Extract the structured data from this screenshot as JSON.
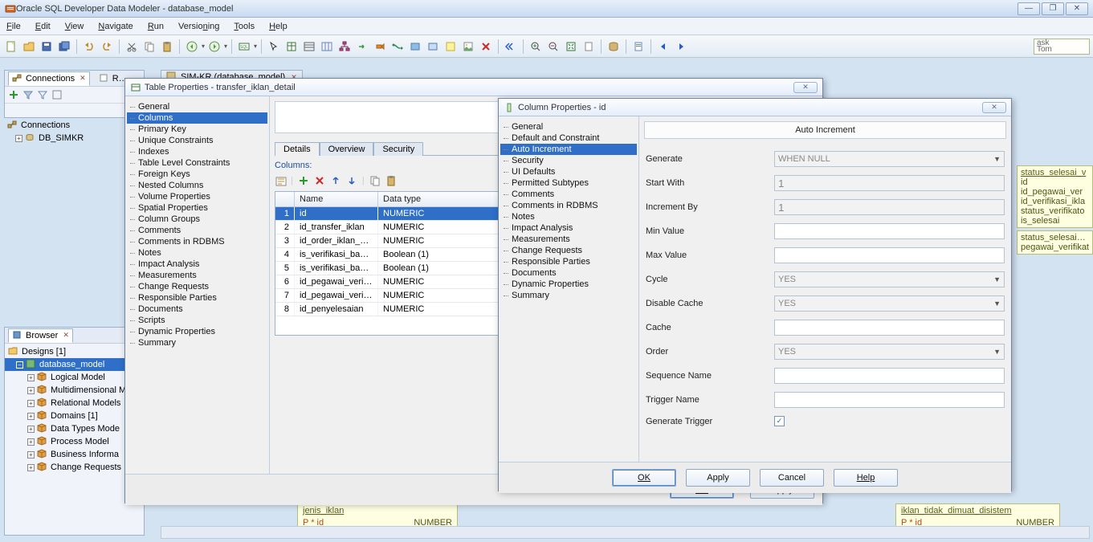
{
  "window": {
    "title": "Oracle SQL Developer Data Modeler - database_model"
  },
  "menu": [
    "File",
    "Edit",
    "View",
    "Navigate",
    "Run",
    "Versioning",
    "Tools",
    "Help"
  ],
  "task_box": [
    "ask",
    "Tom"
  ],
  "left_tabs": {
    "connections": "Connections",
    "r": "R…"
  },
  "connections": {
    "root": "Connections",
    "db": "DB_SIMKR"
  },
  "browser": {
    "title": "Browser",
    "designs": "Designs [1]",
    "model": "database_model",
    "items": [
      "Logical Model",
      "Multidimensional M",
      "Relational Models",
      "Domains [1]",
      "Data Types Mode",
      "Process Model",
      "Business Informa",
      "Change Requests"
    ]
  },
  "doc_tab": "SIM-KR (database_model)",
  "table_dialog": {
    "title": "Table Properties - transfer_iklan_detail",
    "nav": [
      "General",
      "Columns",
      "Primary Key",
      "Unique Constraints",
      "Indexes",
      "Table Level Constraints",
      "Foreign Keys",
      "Nested Columns",
      "Volume Properties",
      "Spatial Properties",
      "Column Groups",
      "Comments",
      "Comments in RDBMS",
      "Notes",
      "Impact Analysis",
      "Measurements",
      "Change Requests",
      "Responsible Parties",
      "Documents",
      "Scripts",
      "Dynamic Properties",
      "Summary"
    ],
    "nav_selected": "Columns",
    "tabs": [
      "Details",
      "Overview",
      "Security"
    ],
    "active_tab": "Details",
    "section": "Columns:",
    "grid": {
      "headers": [
        "",
        "Name",
        "Data type"
      ],
      "rows": [
        {
          "n": "1",
          "name": "id",
          "dtype": "NUMERIC",
          "sel": true
        },
        {
          "n": "2",
          "name": "id_transfer_iklan",
          "dtype": "NUMERIC"
        },
        {
          "n": "3",
          "name": "id_order_iklan_detail",
          "dtype": "NUMERIC"
        },
        {
          "n": "4",
          "name": "is_verifikasi_bag_…",
          "dtype": "Boolean (1)"
        },
        {
          "n": "5",
          "name": "is_verifikasi_bag_…",
          "dtype": "Boolean (1)"
        },
        {
          "n": "6",
          "name": "id_pegawai_verifi…",
          "dtype": "NUMERIC"
        },
        {
          "n": "7",
          "name": "id_pegawai_verifi…",
          "dtype": "NUMERIC"
        },
        {
          "n": "8",
          "name": "id_penyelesaian",
          "dtype": "NUMERIC"
        }
      ]
    },
    "buttons": {
      "ok": "OK",
      "apply": "Apply"
    }
  },
  "column_dialog": {
    "title": "Column Properties - id",
    "nav": [
      "General",
      "Default and Constraint",
      "Auto Increment",
      "Security",
      "UI Defaults",
      "Permitted Subtypes",
      "Comments",
      "Comments in RDBMS",
      "Notes",
      "Impact Analysis",
      "Measurements",
      "Change Requests",
      "Responsible Parties",
      "Documents",
      "Dynamic Properties",
      "Summary"
    ],
    "nav_selected": "Auto Increment",
    "section_title": "Auto Increment",
    "fields": {
      "generate": {
        "label": "Generate",
        "value": "WHEN NULL",
        "type": "select",
        "disabled": true
      },
      "start_with": {
        "label": "Start With",
        "value": "1",
        "type": "text",
        "disabled": true
      },
      "increment_by": {
        "label": "Increment By",
        "value": "1",
        "type": "text",
        "disabled": true
      },
      "min_value": {
        "label": "Min Value",
        "value": "",
        "type": "text"
      },
      "max_value": {
        "label": "Max Value",
        "value": "",
        "type": "text"
      },
      "cycle": {
        "label": "Cycle",
        "value": "YES",
        "type": "select",
        "disabled": true
      },
      "disable_cache": {
        "label": "Disable Cache",
        "value": "YES",
        "type": "select",
        "disabled": true
      },
      "cache": {
        "label": "Cache",
        "value": "",
        "type": "text"
      },
      "order": {
        "label": "Order",
        "value": "YES",
        "type": "select",
        "disabled": true
      },
      "sequence_name": {
        "label": "Sequence Name",
        "value": "",
        "type": "text"
      },
      "trigger_name": {
        "label": "Trigger Name",
        "value": "",
        "type": "text"
      },
      "generate_trigger": {
        "label": "Generate Trigger",
        "value": true,
        "type": "check"
      }
    },
    "buttons": {
      "ok": "OK",
      "apply": "Apply",
      "cancel": "Cancel",
      "help": "Help"
    }
  },
  "right_strip": {
    "box1": {
      "head": "status_selesai_v",
      "rows": [
        "id",
        "id_pegawai_ver",
        "id_verifikasi_ikla",
        "status_verifikato",
        "is_selesai"
      ]
    },
    "box2": {
      "rows": [
        "status_selesai_ve",
        "pegawai_verifikat"
      ]
    }
  },
  "canvas": {
    "jenis_iklan": {
      "title": "jenis_iklan",
      "pk": "P  *  id",
      "dtype": "NUMBER"
    },
    "iklan_box": {
      "title": "iklan_tidak_dimuat_disistem",
      "pk": "P  *  id",
      "dtype": "NUMBER"
    }
  }
}
